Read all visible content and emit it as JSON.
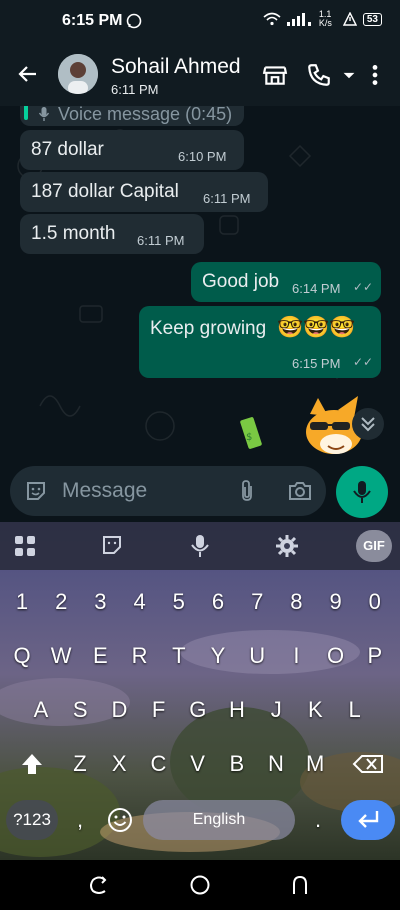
{
  "status": {
    "time": "6:15 PM",
    "speed": "1.1 K/s",
    "battery": "53"
  },
  "header": {
    "contact_name": "Sohail Ahmed",
    "last_seen": "6:11 PM"
  },
  "messages": {
    "voice": {
      "label": "Voice message (0:45)"
    },
    "m1": {
      "text": "87 dollar",
      "time": "6:10 PM"
    },
    "m2": {
      "text": "187 dollar Capital",
      "time": "6:11 PM"
    },
    "m3": {
      "text": "1.5 month",
      "time": "6:11 PM"
    },
    "m4": {
      "text": "Good job",
      "time": "6:14 PM"
    },
    "m5": {
      "text": "Keep growing",
      "emoji": "🤓🤓🤓",
      "time": "6:15 PM"
    }
  },
  "input": {
    "placeholder": "Message"
  },
  "keyboard": {
    "toolbar_gif": "GIF",
    "row_numbers": [
      "1",
      "2",
      "3",
      "4",
      "5",
      "6",
      "7",
      "8",
      "9",
      "0"
    ],
    "row1": [
      "Q",
      "W",
      "E",
      "R",
      "T",
      "Y",
      "U",
      "I",
      "O",
      "P"
    ],
    "row2": [
      "A",
      "S",
      "D",
      "F",
      "G",
      "H",
      "J",
      "K",
      "L"
    ],
    "row3": [
      "Z",
      "X",
      "C",
      "V",
      "B",
      "N",
      "M"
    ],
    "symbols_key": "?123",
    "comma_key": ",",
    "space_label": "English",
    "period_key": "."
  },
  "colors": {
    "bubble_in": "#202c33",
    "bubble_out": "#005c4b",
    "accent": "#00a884",
    "enter_key": "#4a8af4"
  }
}
